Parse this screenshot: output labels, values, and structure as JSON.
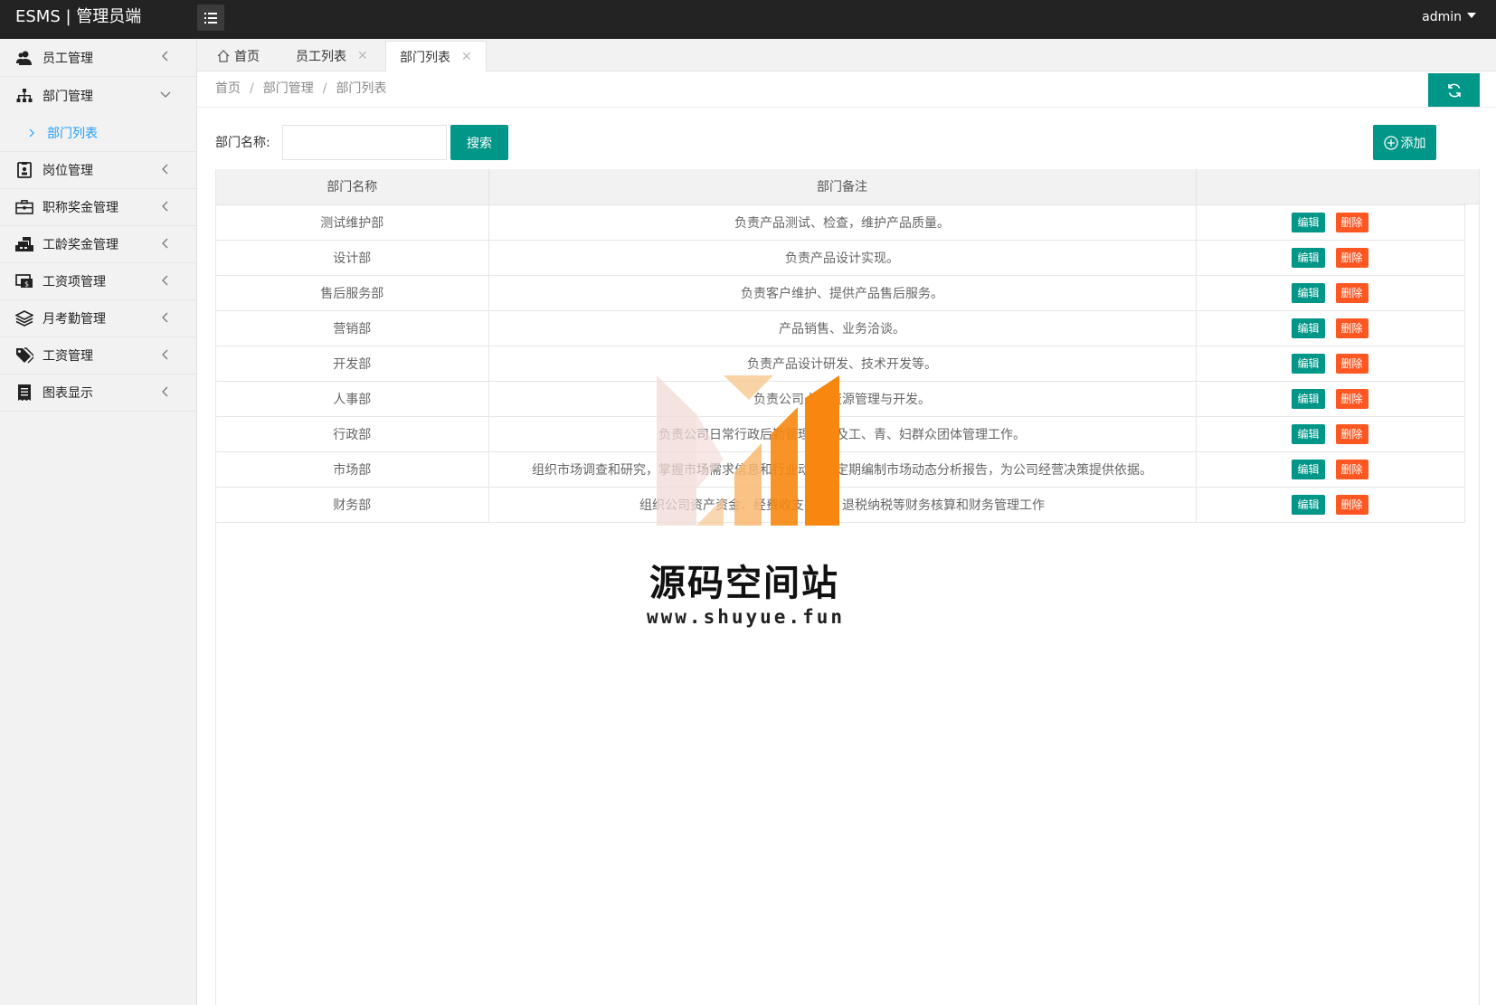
{
  "app": {
    "title": "ESMS | 管理员端",
    "user": "admin"
  },
  "sidebar": {
    "items": [
      {
        "label": "员工管理",
        "icon": "users-icon",
        "expanded": false
      },
      {
        "label": "部门管理",
        "icon": "sitemap-icon",
        "expanded": true,
        "children": [
          {
            "label": "部门列表",
            "active": true
          }
        ]
      },
      {
        "label": "岗位管理",
        "icon": "badge-icon",
        "expanded": false
      },
      {
        "label": "职称奖金管理",
        "icon": "briefcase-icon",
        "expanded": false
      },
      {
        "label": "工龄奖金管理",
        "icon": "cash-register-icon",
        "expanded": false
      },
      {
        "label": "工资项管理",
        "icon": "money-icon",
        "expanded": false
      },
      {
        "label": "月考勤管理",
        "icon": "layers-icon",
        "expanded": false
      },
      {
        "label": "工资管理",
        "icon": "tags-icon",
        "expanded": false
      },
      {
        "label": "图表显示",
        "icon": "receipt-icon",
        "expanded": false
      }
    ]
  },
  "tabs": [
    {
      "label": "首页",
      "icon": "home-icon",
      "closable": false,
      "active": false
    },
    {
      "label": "员工列表",
      "closable": true,
      "active": false
    },
    {
      "label": "部门列表",
      "closable": true,
      "active": true
    }
  ],
  "breadcrumb": [
    "首页",
    "部门管理",
    "部门列表"
  ],
  "search": {
    "label": "部门名称:",
    "value": "",
    "button_label": "搜索"
  },
  "add_button_label": "添加",
  "table": {
    "columns": [
      "部门名称",
      "部门备注",
      ""
    ],
    "action_labels": {
      "edit": "编辑",
      "delete": "删除"
    },
    "rows": [
      {
        "name": "测试维护部",
        "note": "负责产品测试、检查，维护产品质量。"
      },
      {
        "name": "设计部",
        "note": "负责产品设计实现。"
      },
      {
        "name": "售后服务部",
        "note": "负责客户维护、提供产品售后服务。"
      },
      {
        "name": "营销部",
        "note": "产品销售、业务洽谈。"
      },
      {
        "name": "开发部",
        "note": "负责产品设计研发、技术开发等。"
      },
      {
        "name": "人事部",
        "note": "负责公司人力资源管理与开发。"
      },
      {
        "name": "行政部",
        "note": "负责公司日常行政后勤管理、以及工、青、妇群众团体管理工作。"
      },
      {
        "name": "市场部",
        "note": "组织市场调查和研究，掌握市场需求信息和行业动态，定期编制市场动态分析报告，为公司经营决策提供依据。"
      },
      {
        "name": "财务部",
        "note": "组织公司资产资金、经费收支往来、退税纳税等财务核算和财务管理工作"
      }
    ]
  },
  "watermark": {
    "title": "源码空间站",
    "url": "www.shuyue.fun"
  },
  "colors": {
    "topbar": "#232323",
    "primary": "#009688",
    "danger": "#ff5722",
    "link": "#1e9fff",
    "watermark_orange": "#f7870f"
  }
}
